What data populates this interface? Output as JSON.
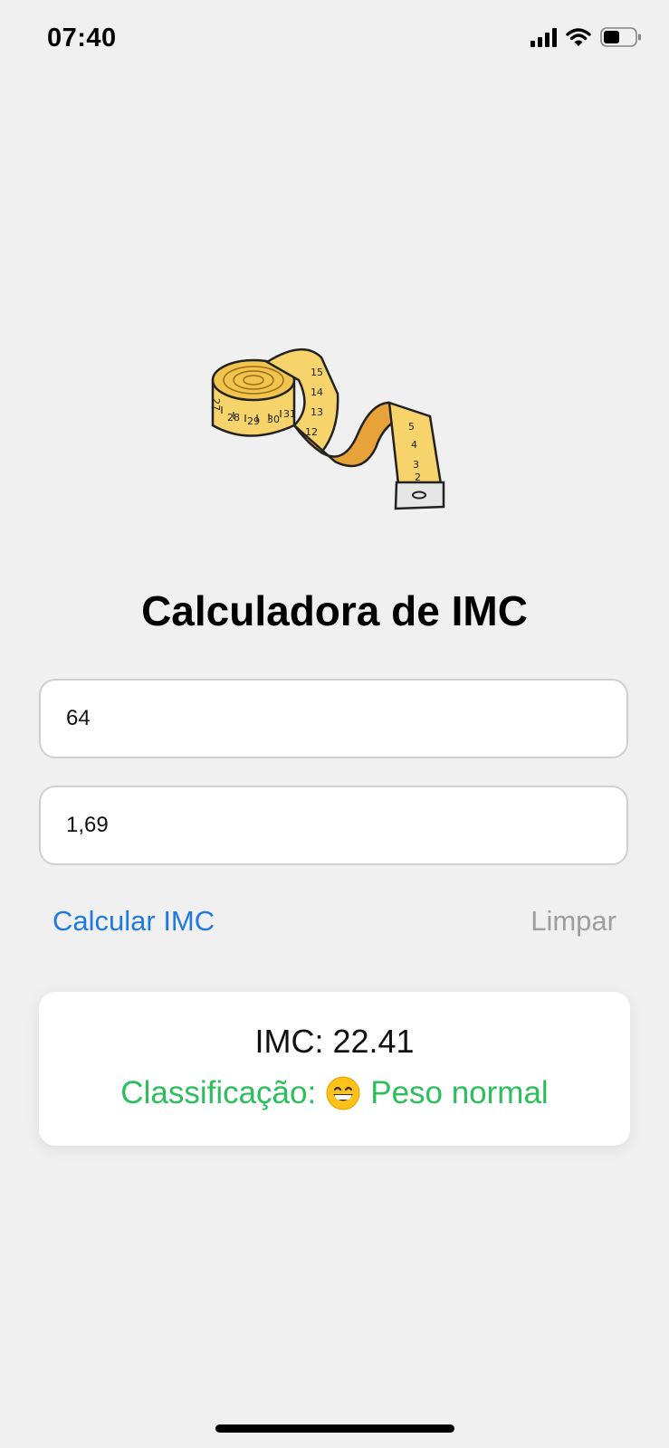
{
  "status_bar": {
    "time": "07:40",
    "icons": [
      "signal-icon",
      "wifi-icon",
      "battery-icon"
    ]
  },
  "hero": {
    "icon": "tape-measure-icon",
    "tape_numbers": [
      "27",
      "28",
      "29",
      "30",
      "31",
      "15",
      "14",
      "13",
      "12",
      "5",
      "4",
      "3",
      "2"
    ]
  },
  "title": "Calculadora de IMC",
  "form": {
    "weight_value": "64",
    "height_value": "1,69"
  },
  "actions": {
    "calculate_label": "Calcular IMC",
    "clear_label": "Limpar"
  },
  "result": {
    "imc_text": "IMC: 22.41",
    "classification_label": "Classificação:",
    "classification_icon": "grinning-face-emoji",
    "classification_value": "Peso normal"
  },
  "colors": {
    "background": "#f0f0f0",
    "accent_blue": "#1f7ae0",
    "secondary_gray": "#9e9e9e",
    "success_green": "#2bbf5c",
    "tape_yellow": "#f6d36b",
    "tape_orange": "#e8a23a"
  }
}
